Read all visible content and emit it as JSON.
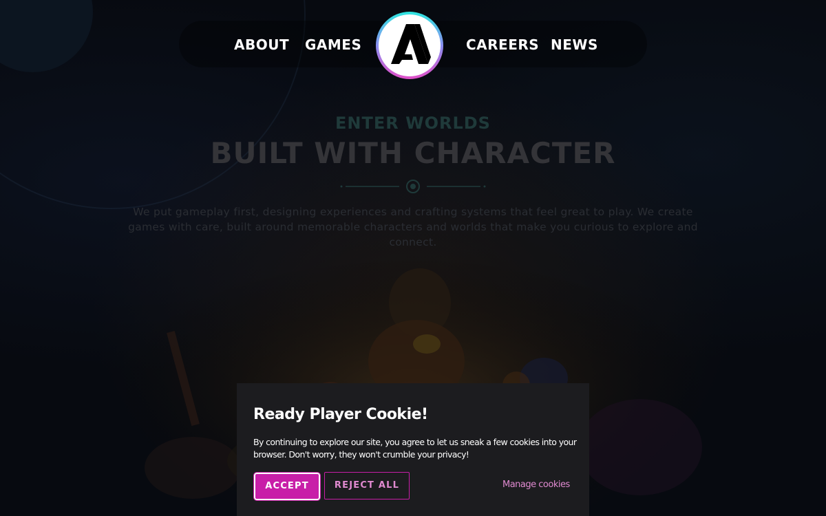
{
  "nav": {
    "about": "ABOUT",
    "games": "GAMES",
    "careers": "CAREERS",
    "news": "NEWS",
    "logo_icon": "studio-logo-icon"
  },
  "hero": {
    "kicker": "ENTER WORLDS",
    "title": "BUILT WITH CHARACTER",
    "description": "We put gameplay first, designing experiences and crafting systems that feel great to play. We create games with care, built around memorable characters and worlds that make you curious to explore and connect."
  },
  "cookie_banner": {
    "title": "Ready Player Cookie!",
    "text": "By continuing to explore our site, you agree to let us sneak a few cookies into your browser. Don't worry, they won't crumble your privacy!",
    "accept_label": "ACCEPT",
    "reject_label": "REJECT ALL",
    "manage_label": "Manage cookies"
  },
  "colors": {
    "accent": "#c81ea8",
    "accent_text": "#e08ad0",
    "banner_bg": "#1c1c1f",
    "page_bg": "#070a10"
  }
}
